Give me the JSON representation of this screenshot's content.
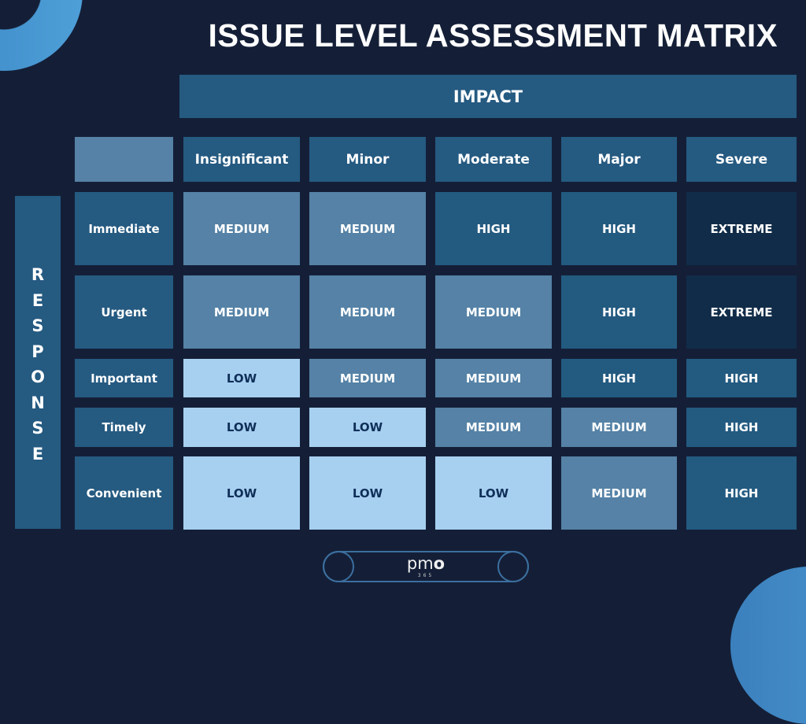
{
  "title": "ISSUE LEVEL ASSESSMENT MATRIX",
  "axes": {
    "impact_label": "IMPACT",
    "response_label": "RESPONSE"
  },
  "columns": [
    "Insignificant",
    "Minor",
    "Moderate",
    "Major",
    "Severe"
  ],
  "rows": [
    {
      "label": "Immediate",
      "cells": [
        "MEDIUM",
        "MEDIUM",
        "HIGH",
        "HIGH",
        "EXTREME"
      ]
    },
    {
      "label": "Urgent",
      "cells": [
        "MEDIUM",
        "MEDIUM",
        "MEDIUM",
        "HIGH",
        "EXTREME"
      ]
    },
    {
      "label": "Important",
      "cells": [
        "LOW",
        "MEDIUM",
        "MEDIUM",
        "HIGH",
        "HIGH"
      ]
    },
    {
      "label": "Timely",
      "cells": [
        "LOW",
        "LOW",
        "MEDIUM",
        "MEDIUM",
        "HIGH"
      ]
    },
    {
      "label": "Convenient",
      "cells": [
        "LOW",
        "LOW",
        "LOW",
        "MEDIUM",
        "HIGH"
      ]
    }
  ],
  "level_colors": {
    "LOW": "#a7d0f0",
    "MEDIUM": "#5582a6",
    "HIGH": "#235a80",
    "EXTREME": "#112c48"
  },
  "logo": {
    "brand": "pm",
    "brand_o": "o",
    "sub": "365"
  }
}
